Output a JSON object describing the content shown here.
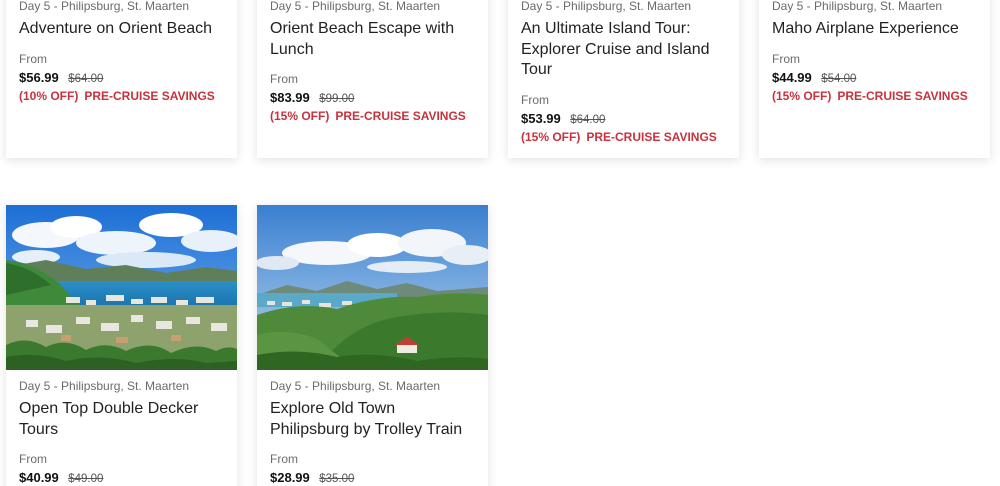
{
  "cards": [
    {
      "location": "Day 5 - Philipsburg, St. Maarten",
      "title": "Adventure on Orient Beach",
      "from_label": "From",
      "price": "$56.99",
      "old_price": "$64.00",
      "discount": "(10% OFF)",
      "savings": "PRE-CRUISE SAVINGS"
    },
    {
      "location": "Day 5 - Philipsburg, St. Maarten",
      "title": "Orient Beach Escape with Lunch",
      "from_label": "From",
      "price": "$83.99",
      "old_price": "$99.00",
      "discount": "(15% OFF)",
      "savings": "PRE-CRUISE SAVINGS"
    },
    {
      "location": "Day 5 - Philipsburg, St. Maarten",
      "title": "An Ultimate Island Tour: Explorer Cruise and Island Tour",
      "from_label": "From",
      "price": "$53.99",
      "old_price": "$64.00",
      "discount": "(15% OFF)",
      "savings": "PRE-CRUISE SAVINGS"
    },
    {
      "location": "Day 5 - Philipsburg, St. Maarten",
      "title": "Maho Airplane Experience",
      "from_label": "From",
      "price": "$44.99",
      "old_price": "$54.00",
      "discount": "(15% OFF)",
      "savings": "PRE-CRUISE SAVINGS"
    },
    {
      "location": "Day 5 - Philipsburg, St. Maarten",
      "title": "Open Top Double Decker Tours",
      "from_label": "From",
      "price": "$40.99",
      "old_price": "$49.00"
    },
    {
      "location": "Day 5 - Philipsburg, St. Maarten",
      "title": "Explore Old Town Philipsburg by Trolley Train",
      "from_label": "From",
      "price": "$28.99",
      "old_price": "$35.00"
    }
  ]
}
